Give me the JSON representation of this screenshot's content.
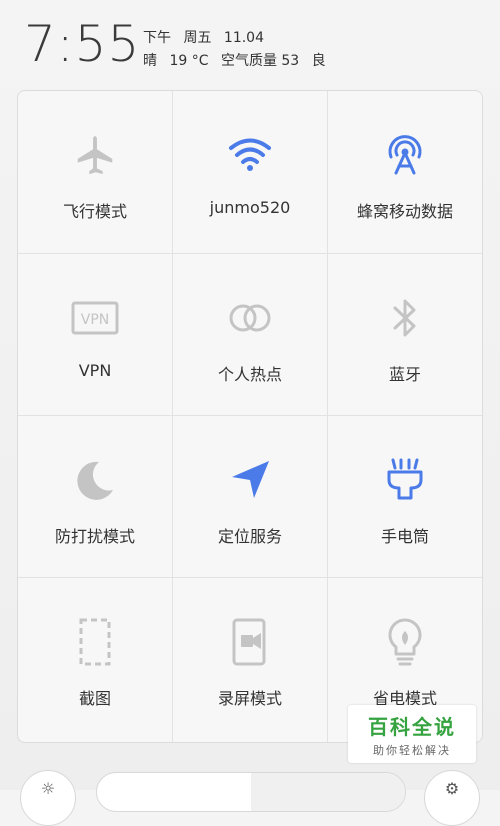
{
  "status": {
    "time": "7:55",
    "ampm": "下午",
    "weekday": "周五",
    "date": "11.04",
    "weather": "晴",
    "temperature": "19 °C",
    "air_quality": "空气质量 53",
    "air_level": "良"
  },
  "colors": {
    "active_blue": "#4a7be8",
    "inactive_gray": "#c4c4c4",
    "watermark_green": "#36a341"
  },
  "tiles": [
    {
      "label": "飞行模式",
      "icon": "airplane-icon",
      "active": false
    },
    {
      "label": "junmo520",
      "icon": "wifi-icon",
      "active": true
    },
    {
      "label": "蜂窝移动数据",
      "icon": "cellular-data-icon",
      "active": true
    },
    {
      "label": "VPN",
      "icon": "vpn-icon",
      "active": false
    },
    {
      "label": "个人热点",
      "icon": "hotspot-icon",
      "active": false
    },
    {
      "label": "蓝牙",
      "icon": "bluetooth-icon",
      "active": false
    },
    {
      "label": "防打扰模式",
      "icon": "moon-icon",
      "active": false
    },
    {
      "label": "定位服务",
      "icon": "location-arrow-icon",
      "active": true
    },
    {
      "label": "手电筒",
      "icon": "flashlight-icon",
      "active": true
    },
    {
      "label": "截图",
      "icon": "screenshot-icon",
      "active": false
    },
    {
      "label": "录屏模式",
      "icon": "screen-record-icon",
      "active": false
    },
    {
      "label": "省电模式",
      "icon": "power-saving-bulb-icon",
      "active": false
    }
  ],
  "vpn_icon_text": "VPN",
  "watermark": {
    "title": "百科全说",
    "subtitle": "助你轻松解决"
  }
}
